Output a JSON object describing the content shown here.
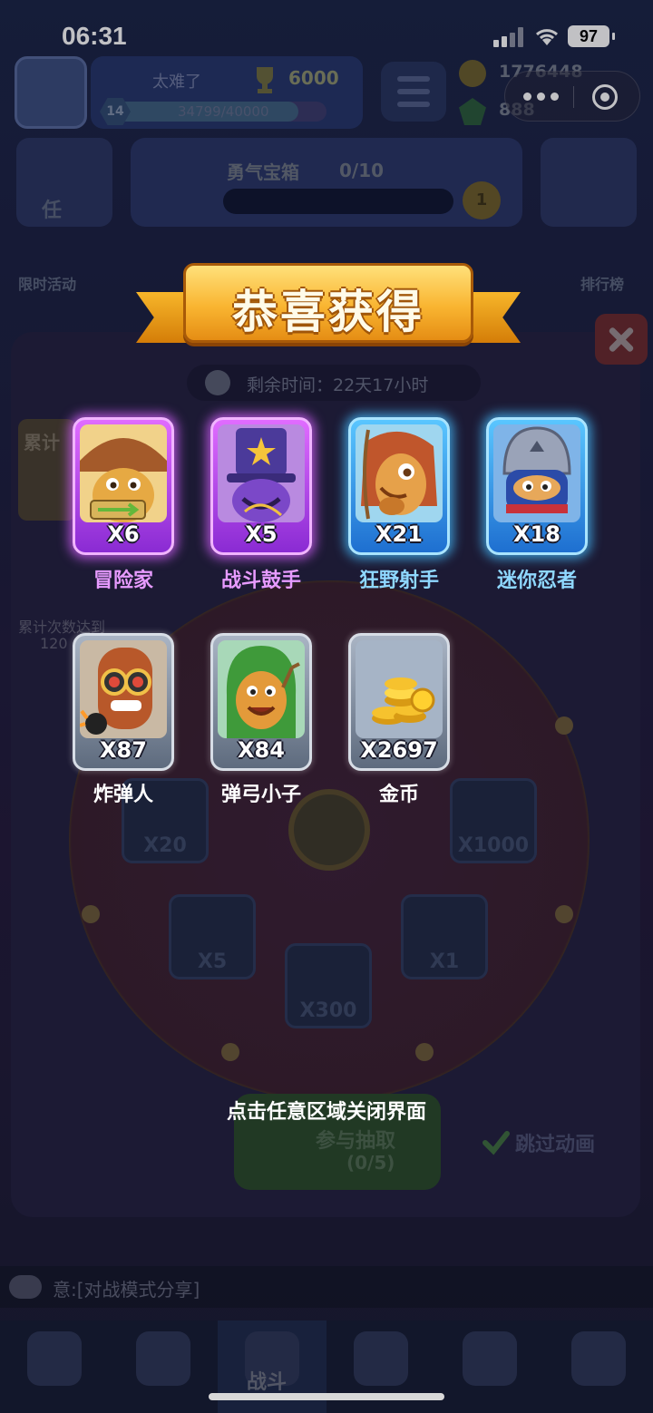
{
  "status_bar": {
    "time": "06:31",
    "battery": "97"
  },
  "background": {
    "player_title": "太难了",
    "trophies": "6000",
    "level": "14",
    "xp": "34799/40000",
    "coins": "1776448",
    "gems": "888",
    "task_label": "任",
    "chest_title": "勇气宝箱",
    "chest_progress": "0/10",
    "chest_count": "1",
    "limited_label": "限时活动",
    "rank_label": "排行榜",
    "timer": "剩余时间：22天17小时",
    "cumulative_label": "累计",
    "cumulative_note": "累计次数达到",
    "cumulative_value": "120",
    "wheel_slots": [
      "X20",
      "X1000",
      "X5",
      "X1",
      "X300",
      "X1",
      "X1"
    ],
    "join_button": "参与抽取",
    "join_progress": "(0/5)",
    "skip_label": "跳过动画",
    "chat_text": "意:[对战模式分享]",
    "nav_battle": "战斗"
  },
  "reward_popup": {
    "title": "恭喜获得",
    "items": [
      {
        "name": "冒险家",
        "qty": "X6",
        "rarity": "purple"
      },
      {
        "name": "战斗鼓手",
        "qty": "X5",
        "rarity": "purple"
      },
      {
        "name": "狂野射手",
        "qty": "X21",
        "rarity": "blue"
      },
      {
        "name": "迷你忍者",
        "qty": "X18",
        "rarity": "blue"
      },
      {
        "name": "炸弹人",
        "qty": "X87",
        "rarity": "grey"
      },
      {
        "name": "弹弓小子",
        "qty": "X84",
        "rarity": "grey"
      },
      {
        "name": "金币",
        "qty": "X2697",
        "rarity": "grey"
      }
    ],
    "close_hint": "点击任意区域关闭界面"
  },
  "colors": {
    "purple_glow": "#d660ff",
    "blue_glow": "#46beff",
    "ribbon_gold": "#f9b531"
  }
}
